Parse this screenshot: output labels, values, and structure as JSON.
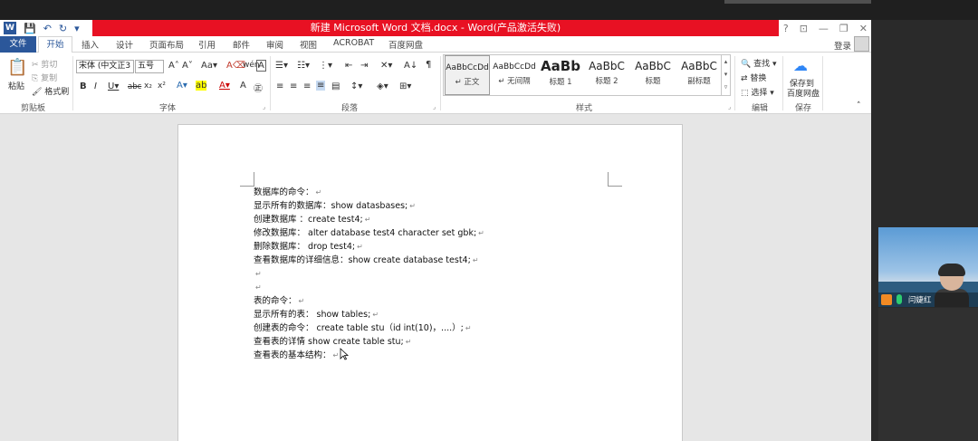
{
  "window": {
    "title": "新建 Microsoft Word 文档.docx - Word(产品激活失败)",
    "qat_label": " ",
    "controls": [
      "?",
      "⊡",
      "—",
      "❐",
      "✕"
    ]
  },
  "tabs": {
    "file": "文件",
    "home": "开始",
    "items": [
      "插入",
      "设计",
      "页面布局",
      "引用",
      "邮件",
      "审阅",
      "视图",
      "ACROBAT",
      "百度网盘"
    ],
    "login": "登录"
  },
  "ribbon": {
    "clipboard": {
      "paste": "粘贴",
      "cut": "剪切",
      "copy": "复制",
      "format_painter": "格式刷",
      "label": "剪贴板"
    },
    "font": {
      "name": "宋体 (中文正3",
      "size": "五号",
      "label": "字体"
    },
    "paragraph": {
      "label": "段落"
    },
    "styles": {
      "label": "样式",
      "items": [
        {
          "sample": "AaBbCcDd",
          "name": "↵ 正文"
        },
        {
          "sample": "AaBbCcDd",
          "name": "↵ 无间隔"
        },
        {
          "sample": "AaBb",
          "name": "标题 1"
        },
        {
          "sample": "AaBbC",
          "name": "标题 2"
        },
        {
          "sample": "AaBbC",
          "name": "标题"
        },
        {
          "sample": "AaBbC",
          "name": "副标题"
        }
      ]
    },
    "editing": {
      "find": "查找",
      "replace": "替换",
      "select": "选择",
      "label": "编辑"
    },
    "save": {
      "line1": "保存到",
      "line2": "百度网盘",
      "label": "保存"
    }
  },
  "document": {
    "lines": [
      "数据库的命令：",
      "显示所有的数据库：show datasbases;",
      "创建数据库 ：create test4;",
      "修改数据库： alter database test4 character set gbk;",
      "删除数据库： drop test4;",
      "查看数据库的详细信息：show create database test4;",
      "",
      "",
      "表的命令：",
      "显示所有的表： show tables;",
      "创建表的命令： create table stu（id int(10)，....）;",
      "查看表的详情 show create table stu;",
      "查看表的基本结构："
    ]
  },
  "video": {
    "name": "闫婕红"
  },
  "colors": {
    "accent": "#2b579a",
    "title_red": "#e81123"
  }
}
